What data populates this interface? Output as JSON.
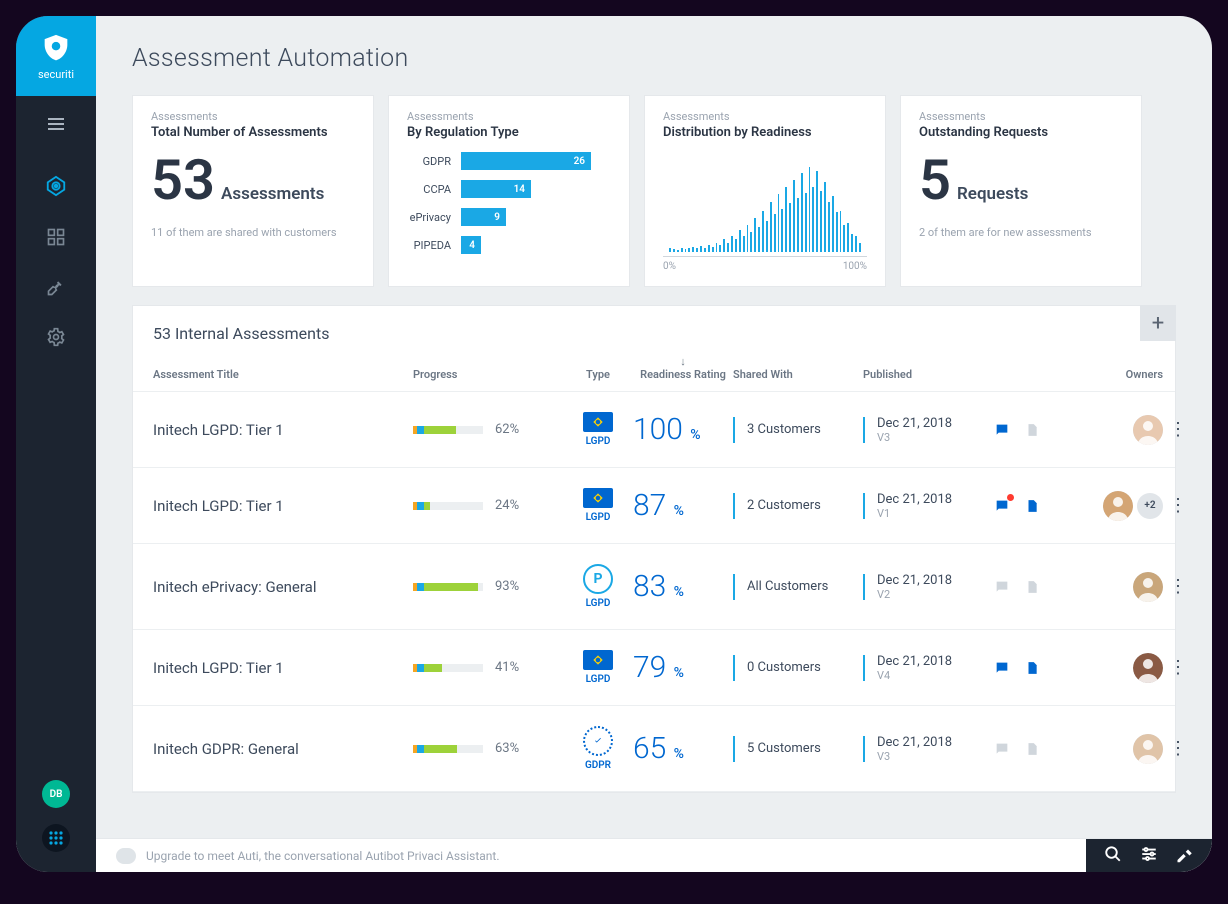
{
  "app": {
    "name": "securiti",
    "user_initials": "DB"
  },
  "page_title": "Assessment Automation",
  "cards": {
    "total": {
      "kicker": "Assessments",
      "title": "Total Number of Assessments",
      "value": "53",
      "unit": "Assessments",
      "sub": "11 of them are shared with customers"
    },
    "by_reg": {
      "kicker": "Assessments",
      "title": "By Regulation Type"
    },
    "dist": {
      "kicker": "Assessments",
      "title": "Distribution by Readiness",
      "axis_min": "0%",
      "axis_max": "100%"
    },
    "outstanding": {
      "kicker": "Assessments",
      "title": "Outstanding Requests",
      "value": "5",
      "unit": "Requests",
      "sub": "2 of them are for new assessments"
    }
  },
  "chart_data": {
    "type": "bar",
    "categories": [
      "GDPR",
      "CCPA",
      "ePrivacy",
      "PIPEDA"
    ],
    "values": [
      26,
      14,
      9,
      4
    ],
    "title": "Assessments By Regulation Type",
    "xlabel": "",
    "ylabel": "",
    "ylim": [
      0,
      30
    ]
  },
  "table": {
    "title": "53 Internal Assessments",
    "headers": {
      "title": "Assessment Title",
      "progress": "Progress",
      "type": "Type",
      "rating": "Readiness Rating",
      "shared": "Shared With",
      "published": "Published",
      "owners": "Owners"
    },
    "rows": [
      {
        "title": "Initech LGPD: Tier 1",
        "progress": 62,
        "type_label": "LGPD",
        "type_kind": "lgpd",
        "rating": "100",
        "shared": "3 Customers",
        "date": "Dec 21, 2018",
        "version": "V3",
        "chat": "blue",
        "file": "gray",
        "hasAlert": false,
        "extraOwners": ""
      },
      {
        "title": "Initech LGPD: Tier 1",
        "progress": 24,
        "type_label": "LGPD",
        "type_kind": "lgpd",
        "rating": "87",
        "shared": "2 Customers",
        "date": "Dec 21, 2018",
        "version": "V1",
        "chat": "blue",
        "file": "blue",
        "hasAlert": true,
        "extraOwners": "+2"
      },
      {
        "title": "Initech ePrivacy: General",
        "progress": 93,
        "type_label": "LGPD",
        "type_kind": "circle",
        "rating": "83",
        "shared": "All Customers",
        "date": "Dec 21, 2018",
        "version": "V2",
        "chat": "gray",
        "file": "gray",
        "hasAlert": false,
        "extraOwners": ""
      },
      {
        "title": "Initech LGPD: Tier 1",
        "progress": 41,
        "type_label": "LGPD",
        "type_kind": "lgpd",
        "rating": "79",
        "shared": "0 Customers",
        "date": "Dec 21, 2018",
        "version": "V4",
        "chat": "blue",
        "file": "blue",
        "hasAlert": false,
        "extraOwners": ""
      },
      {
        "title": "Initech GDPR: General",
        "progress": 63,
        "type_label": "GDPR",
        "type_kind": "gdpr",
        "rating": "65",
        "shared": "5 Customers",
        "date": "Dec 21, 2018",
        "version": "V3",
        "chat": "gray",
        "file": "gray",
        "hasAlert": false,
        "extraOwners": ""
      }
    ]
  },
  "bottom_msg": "Upgrade to meet Auti, the conversational Autibot Privaci Assistant."
}
